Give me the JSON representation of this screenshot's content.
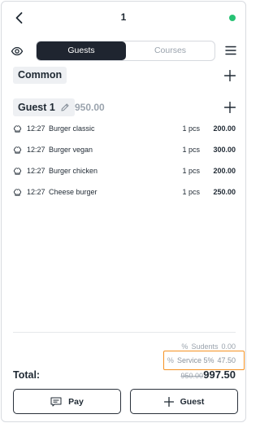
{
  "header": {
    "title": "1",
    "back_icon": "chevron-left-icon",
    "status_color": "#27c274"
  },
  "tabs": {
    "active": "Guests",
    "inactive": "Courses"
  },
  "common": {
    "label": "Common"
  },
  "guest": {
    "name": "Guest 1",
    "sum": "950.00"
  },
  "items": [
    {
      "time": "12:27",
      "name": "Burger classic",
      "qty": "1 pcs",
      "price": "200.00"
    },
    {
      "time": "12:27",
      "name": "Burger vegan",
      "qty": "1 pcs",
      "price": "300.00"
    },
    {
      "time": "12:27",
      "name": "Burger chicken",
      "qty": "1 pcs",
      "price": "200.00"
    },
    {
      "time": "12:27",
      "name": "Cheese burger",
      "qty": "1 pcs",
      "price": "250.00"
    }
  ],
  "summary": {
    "discount_label": "Sudents",
    "discount_value": "0.00",
    "service_label": "Service 5%",
    "service_value": "47.50",
    "total_label": "Total:",
    "total_old": "950.00",
    "total_new": "997.50",
    "highlight_color": "#f59121"
  },
  "actions": {
    "pay_label": "Pay",
    "guest_label": "Guest"
  }
}
